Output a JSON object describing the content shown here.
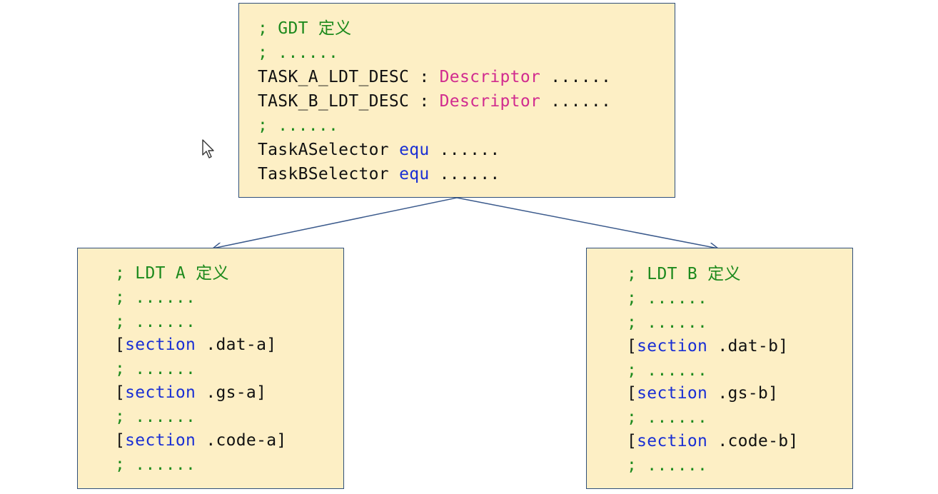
{
  "colors": {
    "box_fill": "#fdefc5",
    "box_border": "#2f4f7a",
    "comment": "#1d8a1d",
    "type": "#d12b8f",
    "keyword": "#1a2fd4",
    "plain": "#111111"
  },
  "gdt": {
    "line1": "; GDT 定义",
    "line2": "; ......",
    "desc_a_name": "TASK_A_LDT_DESC : ",
    "desc_a_type": "Descriptor",
    "desc_a_tail": " ......",
    "desc_b_name": "TASK_B_LDT_DESC : ",
    "desc_b_type": "Descriptor",
    "desc_b_tail": " ......",
    "line5": "; ......",
    "sel_a_name": "TaskASelector ",
    "sel_a_kw": "equ",
    "sel_a_tail": " ......",
    "sel_b_name": "TaskBSelector ",
    "sel_b_kw": "equ",
    "sel_b_tail": " ......"
  },
  "ldt_a": {
    "title": "; LDT A 定义",
    "c1": "; ......",
    "c2": "; ......",
    "sec1_open": "[",
    "sec1_kw": "section",
    "sec1_rest": " .dat-a]",
    "c3": "; ......",
    "sec2_open": "[",
    "sec2_kw": "section",
    "sec2_rest": " .gs-a]",
    "c4": "; ......",
    "sec3_open": "[",
    "sec3_kw": "section",
    "sec3_rest": " .code-a]",
    "c5": "; ......"
  },
  "ldt_b": {
    "title": "; LDT B 定义",
    "c1": "; ......",
    "c2": "; ......",
    "sec1_open": "[",
    "sec1_kw": "section",
    "sec1_rest": " .dat-b]",
    "c3": "; ......",
    "sec2_open": "[",
    "sec2_kw": "section",
    "sec2_rest": " .gs-b]",
    "c4": "; ......",
    "sec3_open": "[",
    "sec3_kw": "section",
    "sec3_rest": " .code-b]",
    "c5": "; ......"
  },
  "icons": {
    "cursor": "mouse-pointer-icon",
    "arrow_left": "arrow-down-left",
    "arrow_right": "arrow-down-right"
  }
}
